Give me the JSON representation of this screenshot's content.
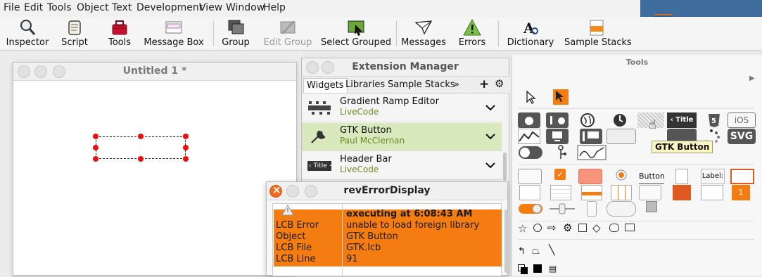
{
  "menu": [
    "File",
    "Edit",
    "Tools",
    "Object",
    "Text",
    "Development",
    "View",
    "Window",
    "Help"
  ],
  "toolbar": {
    "inspector": "Inspector",
    "script": "Script",
    "tools": "Tools",
    "message_box": "Message Box",
    "group": "Group",
    "edit_group": "Edit Group",
    "select_grouped": "Select Grouped",
    "messages": "Messages",
    "errors": "Errors",
    "dictionary": "Dictionary",
    "sample_stacks": "Sample Stacks"
  },
  "stack_window": {
    "title": "Untitled 1 *"
  },
  "extension_manager": {
    "title": "Extension Manager",
    "tabs": [
      "Widgets",
      "Libraries",
      "Sample Stacks",
      "»"
    ],
    "rows": [
      {
        "name": "Gradient Ramp Editor",
        "author": "LiveCode",
        "icon": "gradient-ramp-icon"
      },
      {
        "name": "GTK Button",
        "author": "Paul McClernan",
        "icon": "wrench-icon"
      },
      {
        "name": "Header Bar",
        "author": "LiveCode",
        "icon": "header-bar-icon",
        "icon_text": "‹ Title +"
      }
    ]
  },
  "error_display": {
    "title": "revErrorDisplay",
    "rows": [
      {
        "label": "",
        "value": "executing at 6:08:43 AM"
      },
      {
        "label": "LCB Error",
        "value": "unable to load foreign library"
      },
      {
        "label": "Object",
        "value": "GTK Button"
      },
      {
        "label": "LCB File",
        "value": "GTK.lcb"
      },
      {
        "label": "LCB Line",
        "value": "91"
      }
    ]
  },
  "tools_palette": {
    "title": "Tools",
    "tooltip": "GTK Button",
    "labels": {
      "title_widget": "‹ Title +",
      "svg": "SVG",
      "ios": "iOS",
      "button": "Button",
      "label": "Label:",
      "one": "1"
    }
  },
  "colors": {
    "accent_orange": "#f47c10",
    "selection_green": "#d7e9bd",
    "author_green": "#6a8a22",
    "handle_red": "#e51010"
  }
}
